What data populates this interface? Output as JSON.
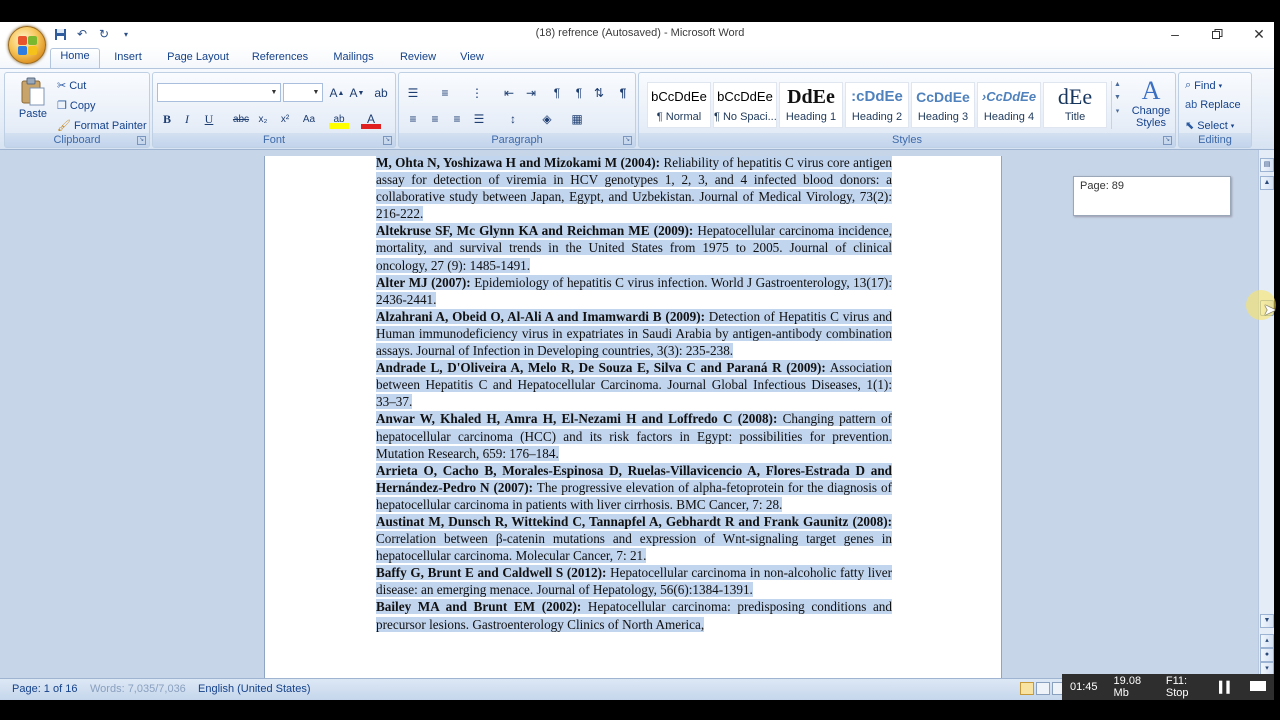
{
  "window": {
    "title": "(18) refrence (Autosaved) - Microsoft Word",
    "qat": [
      "save-icon",
      "undo-icon",
      "redo-icon",
      "customize-icon"
    ]
  },
  "tabs": [
    "Home",
    "Insert",
    "Page Layout",
    "References",
    "Mailings",
    "Review",
    "View"
  ],
  "ribbon": {
    "clipboard": {
      "label": "Clipboard",
      "paste": "Paste",
      "cut": "Cut",
      "copy": "Copy",
      "format_painter": "Format Painter"
    },
    "font": {
      "label": "Font",
      "font_name": "",
      "font_size": ""
    },
    "paragraph": {
      "label": "Paragraph"
    },
    "styles": {
      "label": "Styles",
      "items": [
        {
          "sample": "bCcDdEe",
          "name": "¶ Normal"
        },
        {
          "sample": "bCcDdEe",
          "name": "¶ No Spaci..."
        },
        {
          "sample": "DdEe",
          "name": "Heading 1"
        },
        {
          "sample": ":cDdEe",
          "name": "Heading 2"
        },
        {
          "sample": "CcDdEe",
          "name": "Heading 3"
        },
        {
          "sample": "›CcDdEe",
          "name": "Heading 4"
        },
        {
          "sample": "dEe",
          "name": "Title"
        }
      ],
      "change_styles": "Change Styles"
    },
    "editing": {
      "label": "Editing",
      "find": "Find",
      "replace": "Replace",
      "select": "Select"
    }
  },
  "document": {
    "references": [
      {
        "bold": "M, Ohta N, Yoshizawa H and Mizokami M (2004):",
        "rest": " Reliability of hepatitis C virus core antigen assay for detection of viremia in HCV genotypes 1, 2, 3, and 4 infected blood donors: a collaborative study between Japan, Egypt, and Uzbekistan. Journal of Medical Virology, 73(2): 216-222."
      },
      {
        "bold": "Altekruse SF, Mc Glynn KA and Reichman ME (2009):",
        "rest": " Hepatocellular carcinoma incidence, mortality, and survival trends in the United States from 1975 to 2005. Journal of clinical oncology, 27 (9): 1485-1491."
      },
      {
        "bold": "Alter MJ (2007):",
        "rest": " Epidemiology of hepatitis C virus infection. World J Gastroenterology, 13(17): 2436-2441."
      },
      {
        "bold": "Alzahrani A, Obeid O, Al-Ali A and Imamwardi B (2009):",
        "rest": " Detection of Hepatitis C virus and Human immunodeficiency virus in expatriates in Saudi Arabia by antigen-antibody combination assays. Journal of Infection in Developing countries, 3(3): 235-238."
      },
      {
        "bold": "Andrade L, D'Oliveira A, Melo R, De Souza E, Silva C and Paraná R (2009):",
        "rest": " Association between Hepatitis C and Hepatocellular Carcinoma. Journal Global Infectious Diseases, 1(1): 33–37."
      },
      {
        "bold": "Anwar W, Khaled H, Amra H, El-Nezami H and Loffredo C (2008):",
        "rest": " Changing pattern of hepatocellular carcinoma (HCC) and its risk factors in Egypt: possibilities for prevention. Mutation Research, 659: 176–184."
      },
      {
        "bold": "Arrieta O, Cacho B, Morales-Espinosa D, Ruelas-Villavicencio A, Flores-Estrada D and Hernández-Pedro N (2007):",
        "rest": " The progressive elevation of alpha-fetoprotein for the diagnosis of hepatocellular carcinoma in patients with liver cirrhosis. BMC Cancer, 7: 28."
      },
      {
        "bold": "Austinat M, Dunsch R, Wittekind C, Tannapfel A, Gebhardt R and Frank Gaunitz (2008):",
        "rest": " Correlation between β-catenin mutations and expression of Wnt-signaling target genes in hepatocellular carcinoma. Molecular Cancer, 7: 21."
      },
      {
        "bold": "Baffy G, Brunt E and Caldwell S (2012):",
        "rest": " Hepatocellular carcinoma in non-alcoholic fatty liver disease: an emerging menace. Journal of Hepatology, 56(6):1384-1391."
      },
      {
        "bold": "Bailey MA and Brunt EM (2002):",
        "rest": " Hepatocellular carcinoma: predisposing conditions and precursor lesions. Gastroenterology Clinics of North America,"
      }
    ]
  },
  "page_tip": "Page: 89",
  "status": {
    "page": "Page: 1 of 16",
    "words": "Words: 7,035/7,036",
    "language": "English (United States)"
  },
  "recorder": {
    "time": "01:45",
    "size": "19.08 Mb",
    "stop": "F11: Stop"
  }
}
